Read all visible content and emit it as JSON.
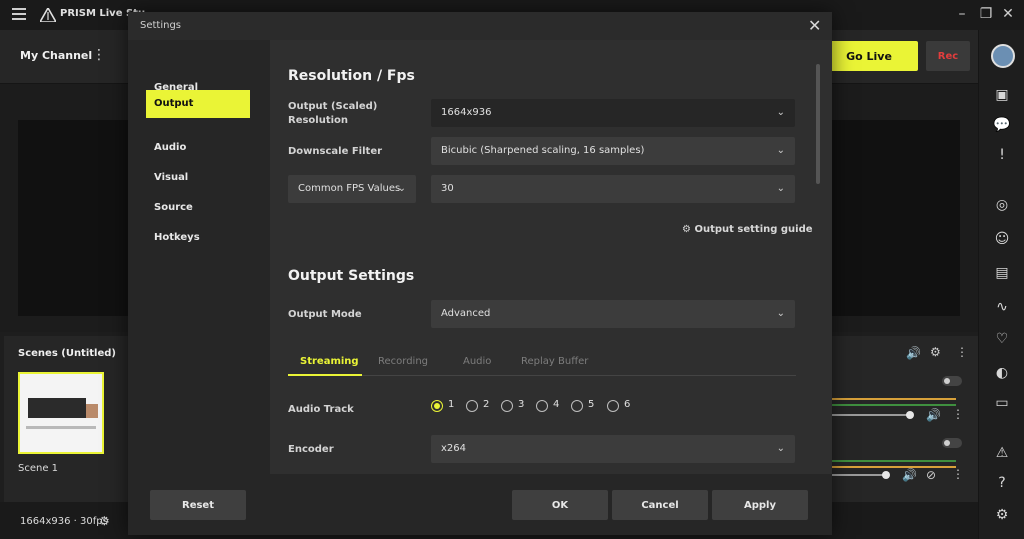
{
  "app": {
    "name": "PRISM Live Stu"
  },
  "header": {
    "channel": "My Channel",
    "go_live": "Go Live",
    "rec": "Rec"
  },
  "scenes": {
    "title": "Scenes  (Untitled)",
    "items": [
      {
        "label": "Scene 1"
      }
    ]
  },
  "status": {
    "text": "1664x936 · 30fps"
  },
  "dialog": {
    "title": "Settings",
    "nav": [
      "General",
      "Output",
      "Audio",
      "Visual",
      "Source",
      "Hotkeys"
    ],
    "active_nav": "Output",
    "resolution": {
      "title": "Resolution / Fps",
      "output_label": "Output (Scaled) Resolution",
      "output_label_line1": "Output (Scaled)",
      "output_label_line2": "Resolution",
      "output_value": "1664x936",
      "downscale_label": "Downscale Filter",
      "downscale_value": "Bicubic (Sharpened scaling, 16 samples)",
      "fps_type": "Common FPS Values",
      "fps_value": "30",
      "guide": "Output setting guide"
    },
    "output_settings": {
      "title": "Output Settings",
      "mode_label": "Output Mode",
      "mode_value": "Advanced",
      "tabs": [
        "Streaming",
        "Recording",
        "Audio",
        "Replay Buffer"
      ],
      "active_tab": "Streaming",
      "audio_track_label": "Audio Track",
      "audio_tracks": [
        "1",
        "2",
        "3",
        "4",
        "5",
        "6"
      ],
      "selected_track": "1",
      "encoder_label": "Encoder",
      "encoder_value": "x264"
    },
    "footer": {
      "reset": "Reset",
      "ok": "OK",
      "cancel": "Cancel",
      "apply": "Apply"
    }
  },
  "colors": {
    "accent": "#eaf436",
    "rec_red": "#e23d3d",
    "dialog_bg": "#2b2b2b"
  }
}
